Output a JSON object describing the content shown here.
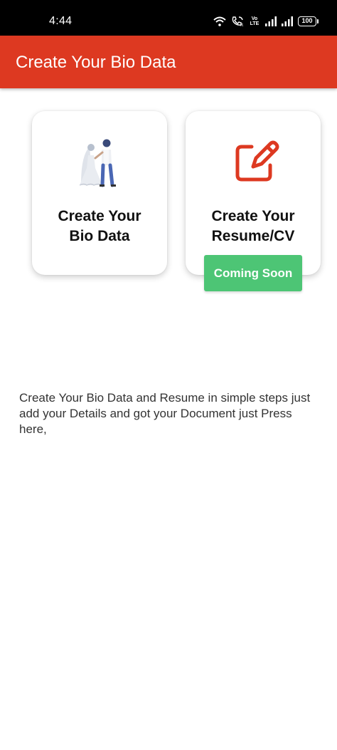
{
  "status_bar": {
    "time": "4:44",
    "volte_top": "Vo",
    "volte_bottom": "LTE",
    "battery_level": "100",
    "icons": [
      "wifi-icon",
      "wifi-calling-icon",
      "volte-icon",
      "signal-icon",
      "signal-icon",
      "battery-icon"
    ]
  },
  "app_bar": {
    "title": "Create Your Bio Data",
    "color": "#dd3921"
  },
  "cards": {
    "bio": {
      "label": "Create Your\nBio Data",
      "icon": "wedding-couple-icon"
    },
    "resume": {
      "label": "Create Your\nResume/CV",
      "icon": "edit-icon",
      "icon_color": "#dd3921"
    }
  },
  "coming_soon": {
    "label": "Coming Soon",
    "color": "#4dc575"
  },
  "description": "Create Your Bio Data and Resume in simple steps just add your Details and got your Document just Press here,"
}
